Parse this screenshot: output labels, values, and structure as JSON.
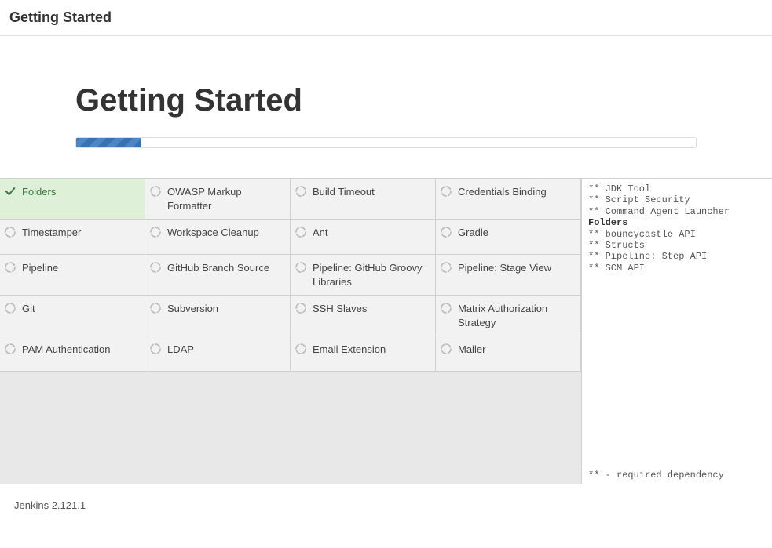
{
  "header": {
    "title": "Getting Started"
  },
  "page": {
    "title": "Getting Started"
  },
  "progress": {
    "percent": 10.5
  },
  "plugins": {
    "rows": [
      [
        {
          "name": "Folders",
          "status": "done"
        },
        {
          "name": "OWASP Markup Formatter",
          "status": "pending"
        },
        {
          "name": "Build Timeout",
          "status": "pending"
        },
        {
          "name": "Credentials Binding",
          "status": "pending"
        }
      ],
      [
        {
          "name": "Timestamper",
          "status": "pending"
        },
        {
          "name": "Workspace Cleanup",
          "status": "pending"
        },
        {
          "name": "Ant",
          "status": "pending"
        },
        {
          "name": "Gradle",
          "status": "pending"
        }
      ],
      [
        {
          "name": "Pipeline",
          "status": "pending"
        },
        {
          "name": "GitHub Branch Source",
          "status": "pending"
        },
        {
          "name": "Pipeline: GitHub Groovy Libraries",
          "status": "pending"
        },
        {
          "name": "Pipeline: Stage View",
          "status": "pending"
        }
      ],
      [
        {
          "name": "Git",
          "status": "pending"
        },
        {
          "name": "Subversion",
          "status": "pending"
        },
        {
          "name": "SSH Slaves",
          "status": "pending"
        },
        {
          "name": "Matrix Authorization Strategy",
          "status": "pending"
        }
      ],
      [
        {
          "name": "PAM Authentication",
          "status": "pending"
        },
        {
          "name": "LDAP",
          "status": "pending"
        },
        {
          "name": "Email Extension",
          "status": "pending"
        },
        {
          "name": "Mailer",
          "status": "pending"
        }
      ]
    ]
  },
  "log": {
    "lines": [
      {
        "text": "** JDK Tool",
        "bold": false
      },
      {
        "text": "** Script Security",
        "bold": false
      },
      {
        "text": "** Command Agent Launcher",
        "bold": false
      },
      {
        "text": "Folders",
        "bold": true
      },
      {
        "text": "** bouncycastle API",
        "bold": false
      },
      {
        "text": "** Structs",
        "bold": false
      },
      {
        "text": "** Pipeline: Step API",
        "bold": false
      },
      {
        "text": "** SCM API",
        "bold": false
      }
    ],
    "footer": "** - required dependency"
  },
  "footer": {
    "version": "Jenkins 2.121.1"
  }
}
